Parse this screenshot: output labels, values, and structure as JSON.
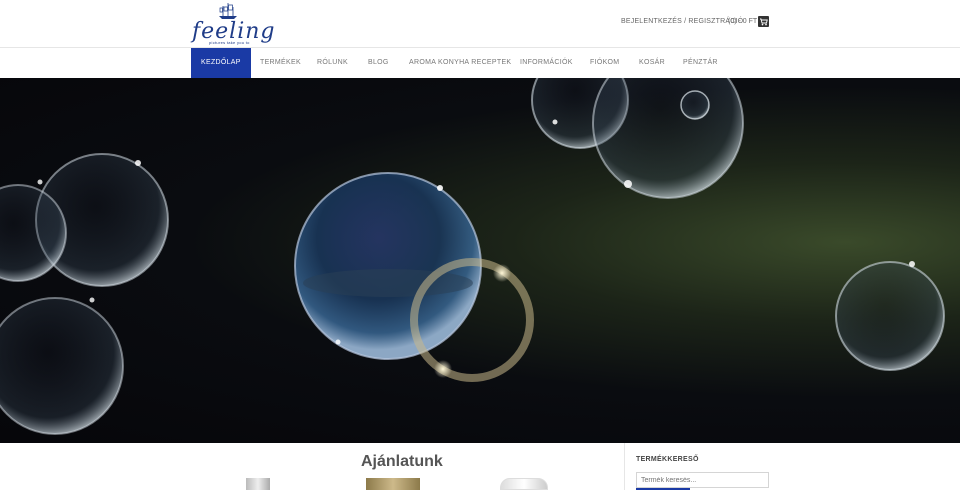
{
  "header": {
    "logo_text": "feeling",
    "logo_tagline": "pictures take you to",
    "login_label": "BEJELENTKEZÉS / REGISZTRÁCIÓ",
    "cart_label": "(0) - 0 FT",
    "cart_icon": "cart-icon"
  },
  "nav": {
    "items": [
      {
        "label": "KEZDŐLAP",
        "active": true
      },
      {
        "label": "TERMÉKEK"
      },
      {
        "label": "RÓLUNK"
      },
      {
        "label": "BLOG"
      },
      {
        "label": "AROMA KONYHA RECEPTEK"
      },
      {
        "label": "INFORMÁCIÓK"
      },
      {
        "label": "FIÓKOM"
      },
      {
        "label": "KOSÁR"
      },
      {
        "label": "PÉNZTÁR"
      }
    ],
    "active_color": "#1a3aa5"
  },
  "main": {
    "section_title": "Ajánlatunk"
  },
  "sidebar": {
    "search_title": "TERMÉKKERESŐ",
    "search_placeholder": "Termék keresés..."
  }
}
